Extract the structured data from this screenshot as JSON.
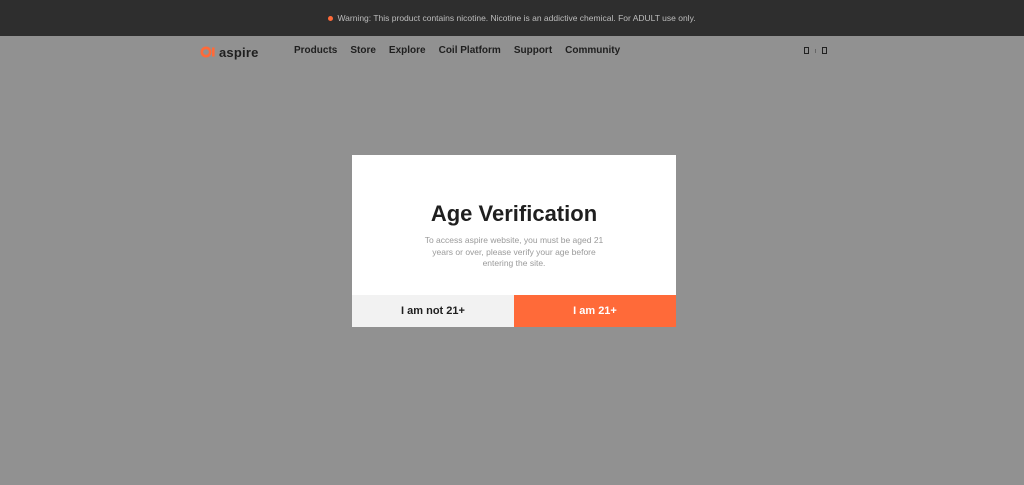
{
  "colors": {
    "accent": "#ff6a39",
    "overlay": "#919191",
    "warning_bg": "#2e2e2e"
  },
  "warning": {
    "text": "Warning: This product contains nicotine. Nicotine is an addictive chemical. For ADULT use only."
  },
  "header": {
    "logo_text": "aspire",
    "logo_icon": "aspire-logo-icon",
    "nav": [
      "Products",
      "Store",
      "Explore",
      "Coil Platform",
      "Support",
      "Community"
    ],
    "icons": [
      "search-icon",
      "divider",
      "cart-icon"
    ]
  },
  "modal": {
    "title": "Age Verification",
    "description": "To access aspire website, you must be aged 21 years or over, please verify your age before entering the site.",
    "decline_label": "I am not 21+",
    "accept_label": "I am 21+"
  }
}
